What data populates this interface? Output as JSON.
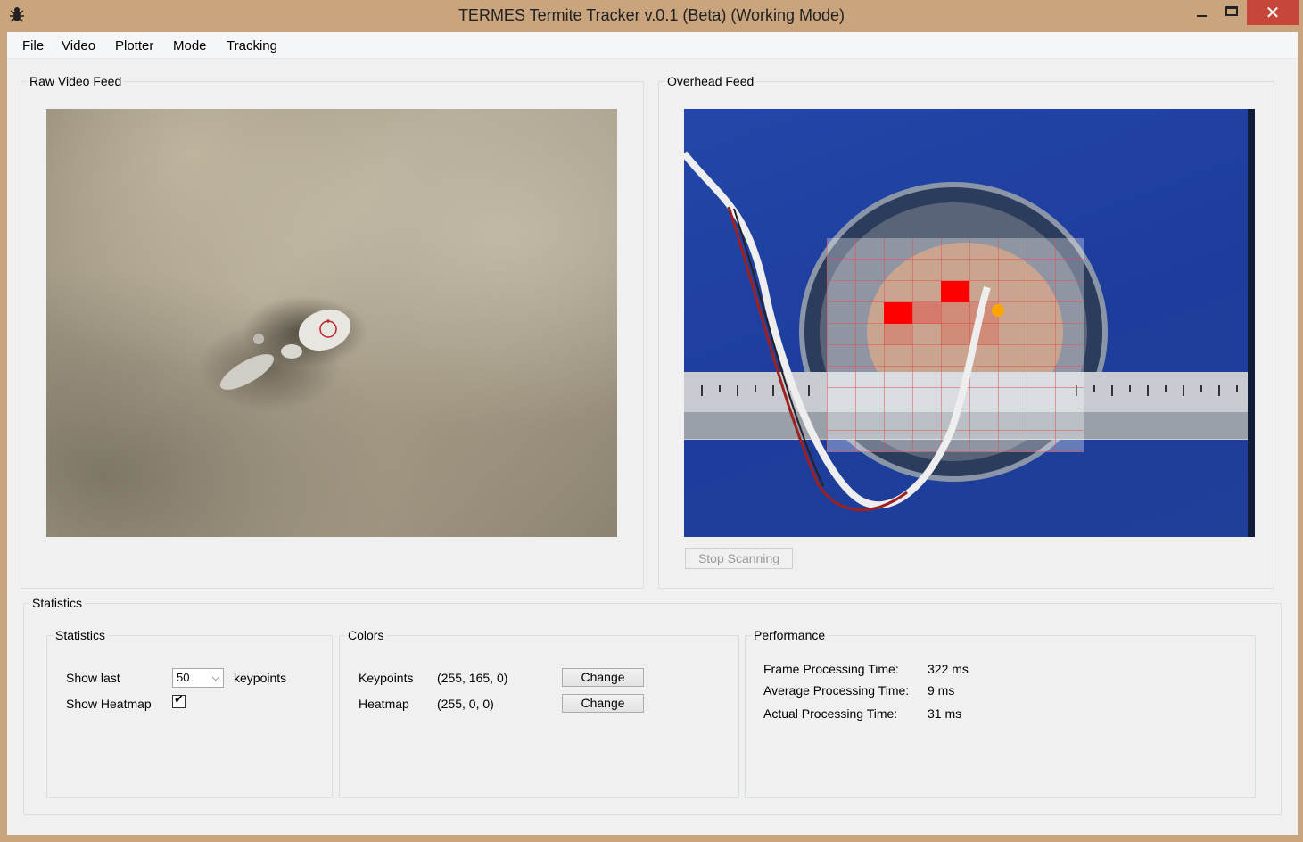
{
  "window": {
    "title": "TERMES Termite Tracker v.0.1 (Beta) (Working Mode)",
    "close_glyph": "✕",
    "accent": "#c9a47d",
    "close_color": "#c7463a"
  },
  "menu": [
    "File",
    "Video",
    "Plotter",
    "Mode",
    "Tracking"
  ],
  "raw_feed": {
    "label": "Raw Video Feed"
  },
  "overhead_feed": {
    "label": "Overhead Feed",
    "stop_button": "Stop Scanning"
  },
  "statistics": {
    "outer_label": "Statistics",
    "inner_label": "Statistics",
    "show_last_label": "Show last",
    "show_last_value": "50",
    "keypoints_suffix": "keypoints",
    "show_heatmap_label": "Show Heatmap",
    "show_heatmap_checked": true,
    "checkmark": "✔"
  },
  "colors": {
    "label": "Colors",
    "keypoints_label": "Keypoints",
    "keypoints_value": "(255, 165, 0)",
    "heatmap_label": "Heatmap",
    "heatmap_value": "(255, 0, 0)",
    "change_label": "Change",
    "keypoint_color": "#ffa500",
    "heatmap_color": "#ff0000"
  },
  "performance": {
    "label": "Performance",
    "rows": [
      {
        "label": "Frame Processing Time:",
        "value": "322 ms"
      },
      {
        "label": "Average Processing Time:",
        "value": "9 ms"
      },
      {
        "label": "Actual Processing Time:",
        "value": "31 ms"
      }
    ]
  }
}
